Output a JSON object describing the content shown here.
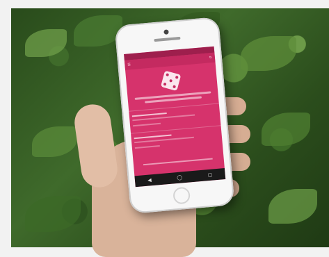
{
  "scene": {
    "description_label": "",
    "colors": {
      "background": "#f2f2f2",
      "foliage": "#3f6a2b",
      "app_primary": "#d6336c",
      "app_dark": "#9e1f4d",
      "phone_body": "#f7f7f7",
      "navbar": "#1a1a1a"
    }
  },
  "phone": {
    "statusbar": {
      "left": "",
      "right": ""
    },
    "appbar": {
      "title": "",
      "menu_icon": "menu-icon",
      "refresh_icon": "refresh-icon"
    },
    "icons": [
      "dice-icon",
      "back-icon",
      "home-icon",
      "recents-icon"
    ]
  }
}
